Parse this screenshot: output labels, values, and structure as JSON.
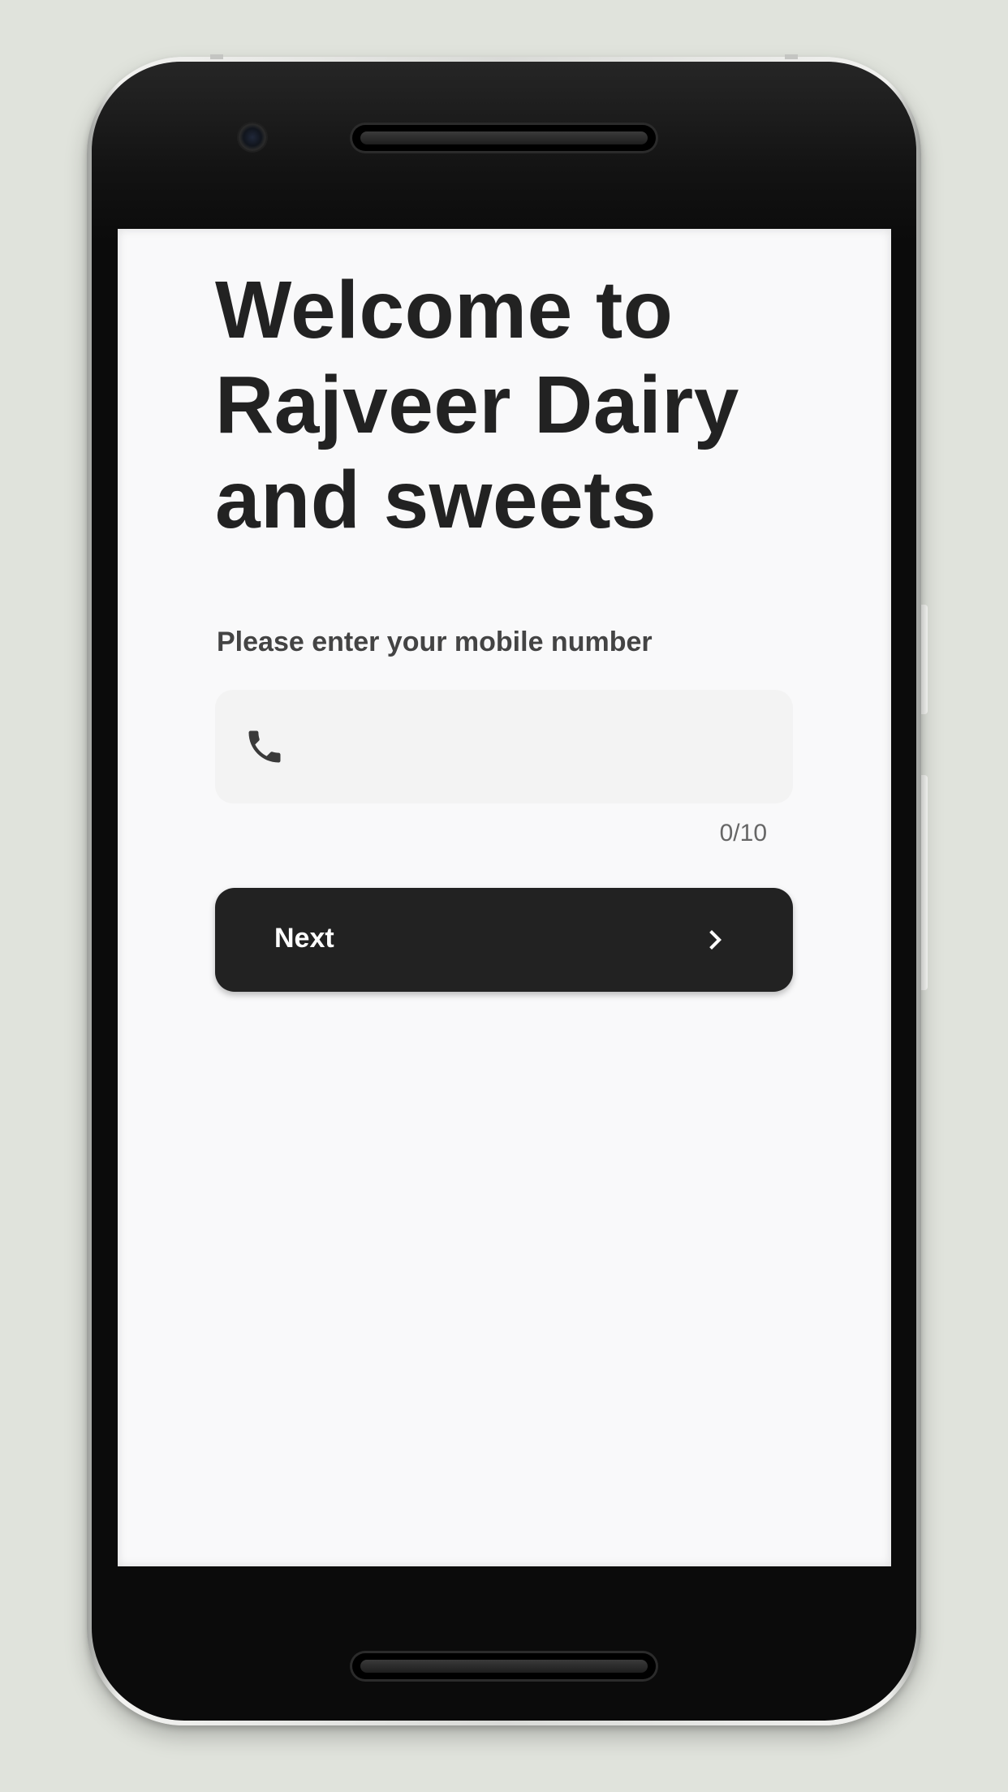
{
  "welcome": {
    "title_lines": [
      "Welcome to",
      "Rajveer Dairy",
      "and sweets"
    ]
  },
  "login": {
    "prompt": "Please enter your mobile number",
    "phone_value": "",
    "counter": "0/10",
    "field_icon": "phone-icon"
  },
  "next_button": {
    "label": "Next",
    "icon": "chevron-right-icon"
  },
  "colors": {
    "page_background": "#e0e3dc",
    "screen_background": "#f9f9fa",
    "title_text": "#222222",
    "prompt_text": "#444444",
    "field_background": "#f3f3f3",
    "button_background": "#222222",
    "button_text": "#ffffff"
  }
}
